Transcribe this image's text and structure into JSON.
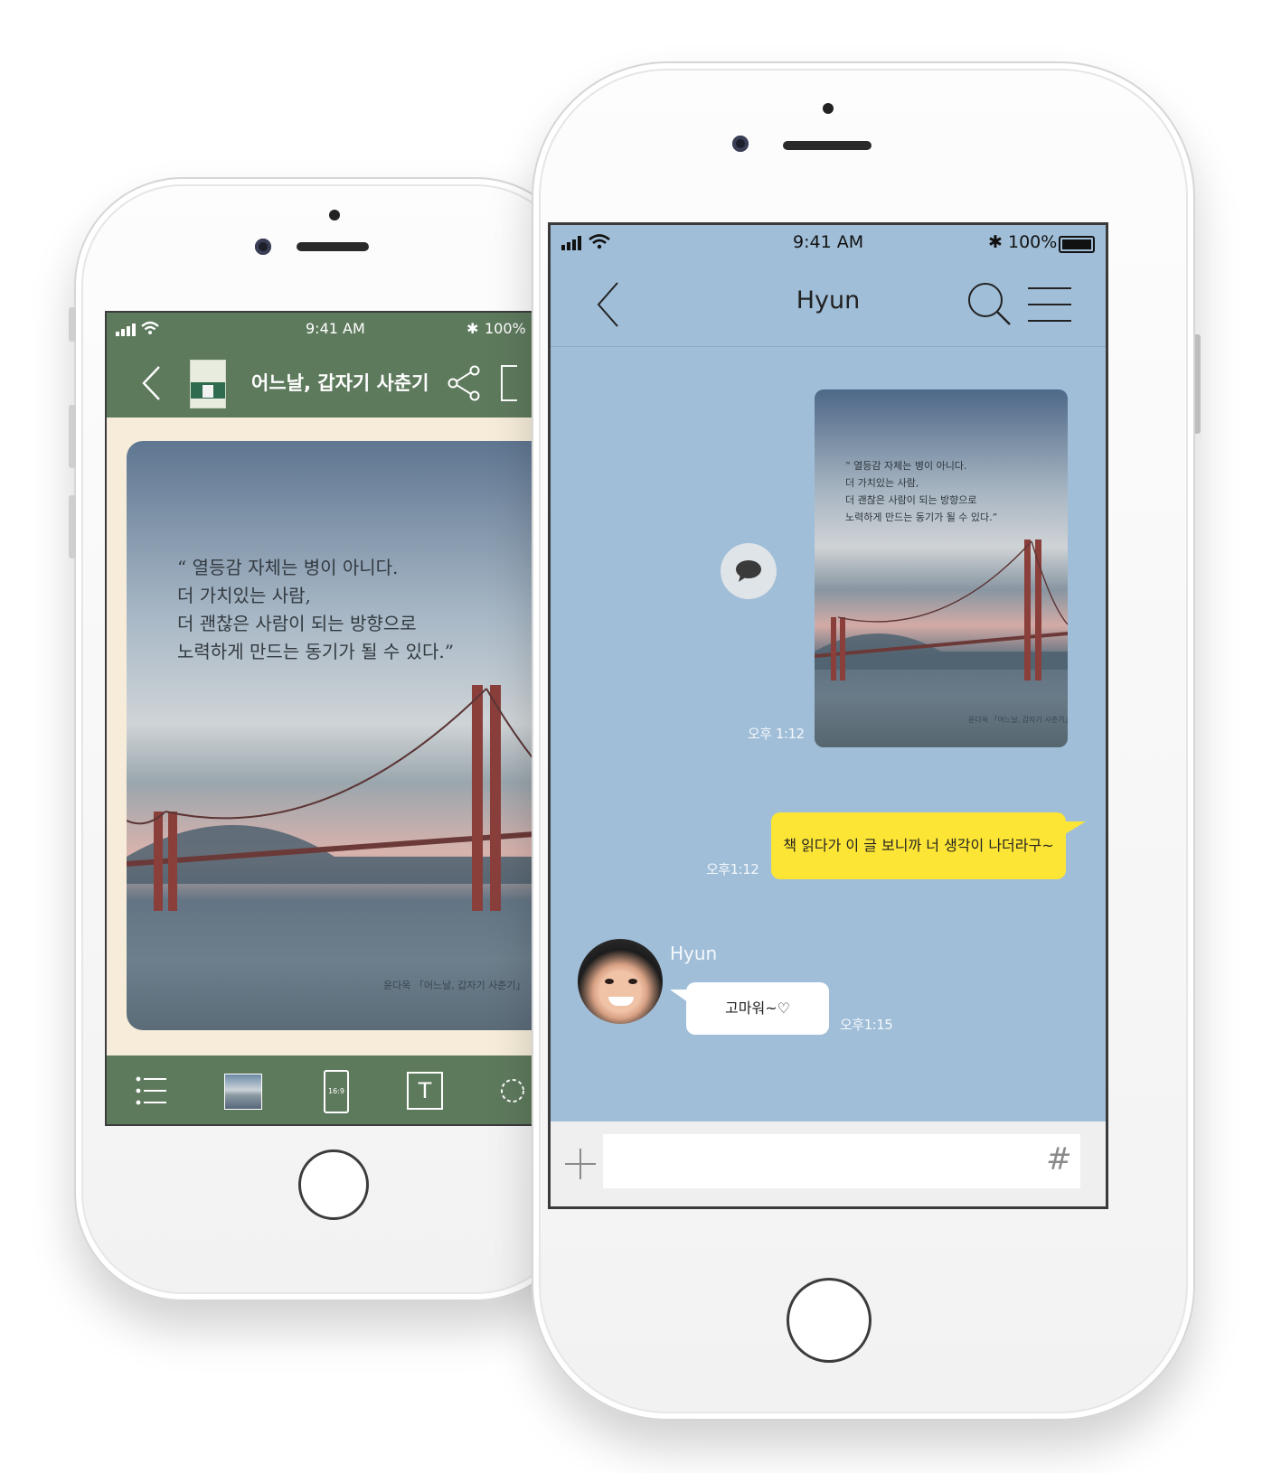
{
  "back_phone": {
    "status": {
      "time": "9:41 AM",
      "battery": "100%"
    },
    "nav": {
      "title": "어느날, 갑자기 사춘기"
    },
    "quote": {
      "lines": [
        "“ 열등감 자체는 병이 아니다.",
        "더 가치있는 사람,",
        "더 괜찮은 사람이 되는 방향으로",
        "노력하게 만드는 동기가 될 수 있다.”"
      ],
      "credit": "윤다옥 「어느날, 갑자기 사춘기」"
    },
    "toolbar": {
      "ratio_label": "16:9",
      "text_label": "T"
    },
    "colors": {
      "bar": "#5e7a5d",
      "page": "#f6ecd9"
    }
  },
  "front_phone": {
    "status": {
      "time": "9:41 AM",
      "battery": "100%"
    },
    "nav": {
      "title": "Hyun"
    },
    "messages": {
      "image": {
        "quote_lines": [
          "“ 열등감 자체는 병이 아니다.",
          "더 가치있는 사람,",
          "더 괜찮은 사람이 되는 방향으로",
          "노력하게 만드는 동기가 될 수 있다.”"
        ],
        "credit": "윤다옥 「어느날, 갑자기 사춘기」",
        "time": "오후 1:12"
      },
      "sent_text": {
        "text": "책 읽다가 이 글 보니까 너 생각이 나더라구~",
        "time": "오후1:12"
      },
      "received": {
        "sender": "Hyun",
        "text": "고마워~♡",
        "time": "오후1:15"
      }
    },
    "input": {
      "hash": "#"
    },
    "colors": {
      "background": "#a0bed8",
      "sent_bubble": "#fde535",
      "received_bubble": "#ffffff"
    }
  }
}
